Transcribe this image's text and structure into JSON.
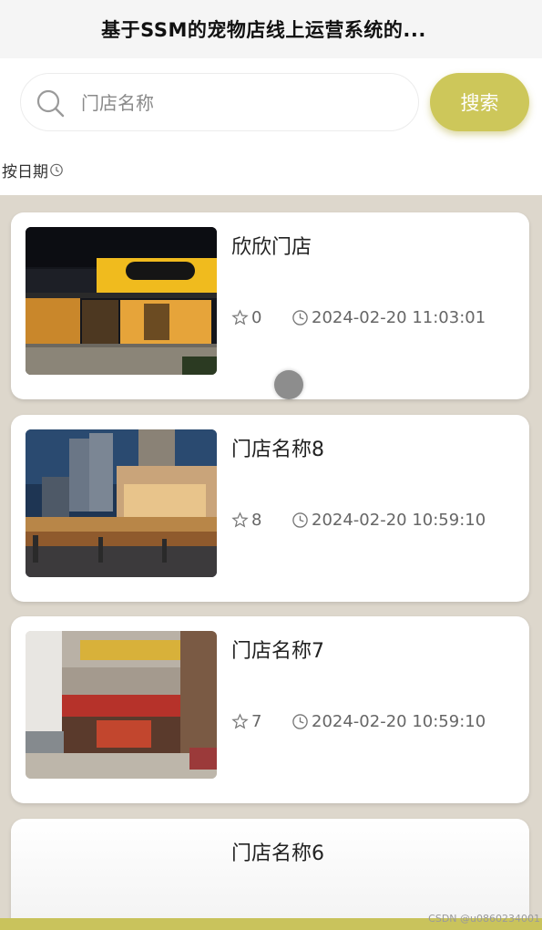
{
  "header": {
    "title": "基于SSM的宠物店线上运营系统的..."
  },
  "search": {
    "placeholder": "门店名称",
    "value": "",
    "button_label": "搜索"
  },
  "sort": {
    "label": "按日期"
  },
  "stores": [
    {
      "name": "欣欣门店",
      "count": "0",
      "time": "2024-02-20 11:03:01"
    },
    {
      "name": "门店名称8",
      "count": "8",
      "time": "2024-02-20 10:59:10"
    },
    {
      "name": "门店名称7",
      "count": "7",
      "time": "2024-02-20 10:59:10"
    },
    {
      "name": "门店名称6"
    }
  ],
  "watermark": "CSDN @u0860234001",
  "colors": {
    "accent": "#cdc75a",
    "list_background": "#ddd7cc",
    "loading_dot": "#8d8d8d"
  },
  "icons": {
    "search": "search-icon",
    "sort": "clock-icon",
    "count": "star-icon",
    "time": "clock-icon"
  }
}
